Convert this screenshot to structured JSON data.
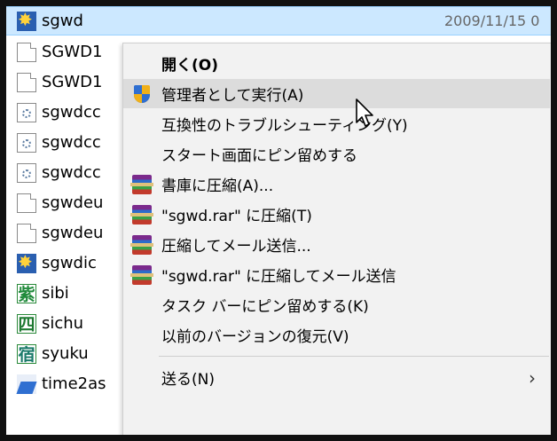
{
  "files": [
    {
      "name": "sgwd",
      "icon": "burst-app-icon",
      "date": "2009/11/15 0",
      "selected": true
    },
    {
      "name": "SGWD1",
      "icon": "document-icon"
    },
    {
      "name": "SGWD1",
      "icon": "document-icon"
    },
    {
      "name": "sgwdcc",
      "icon": "settings-file-icon"
    },
    {
      "name": "sgwdcc",
      "icon": "settings-file-icon"
    },
    {
      "name": "sgwdcc",
      "icon": "settings-file-icon"
    },
    {
      "name": "sgwdeu",
      "icon": "document-icon"
    },
    {
      "name": "sgwdeu",
      "icon": "document-icon"
    },
    {
      "name": "sgwdic",
      "icon": "burst-app-icon"
    },
    {
      "name": "sibi",
      "icon": "kanji-icon",
      "glyph": "紫"
    },
    {
      "name": "sichu",
      "icon": "kanji-icon",
      "glyph": "四"
    },
    {
      "name": "syuku",
      "icon": "kanji-icon",
      "glyph": "宿"
    },
    {
      "name": "time2as",
      "icon": "time-app-icon"
    }
  ],
  "menu": {
    "items": [
      {
        "label": "開く(O)",
        "bold": true,
        "icon": null
      },
      {
        "label": "管理者として実行(A)",
        "icon": "shield-icon",
        "hover": true
      },
      {
        "label": "互換性のトラブルシューティング(Y)",
        "icon": null
      },
      {
        "label": "スタート画面にピン留めする",
        "icon": null
      },
      {
        "label": "書庫に圧縮(A)...",
        "icon": "rar-icon"
      },
      {
        "label": "\"sgwd.rar\" に圧縮(T)",
        "icon": "rar-icon"
      },
      {
        "label": "圧縮してメール送信...",
        "icon": "rar-icon"
      },
      {
        "label": "\"sgwd.rar\" に圧縮してメール送信",
        "icon": "rar-icon"
      },
      {
        "label": "タスク バーにピン留めする(K)",
        "icon": null
      },
      {
        "label": "以前のバージョンの復元(V)",
        "icon": null
      },
      {
        "label": "送る(N)",
        "icon": null,
        "submenu": true
      }
    ],
    "submenu_arrow": "›"
  },
  "colors": {
    "selection": "#cce8ff",
    "menu_bg": "#f2f2f2",
    "menu_hover": "#dcdcdc",
    "frame": "#111111"
  }
}
